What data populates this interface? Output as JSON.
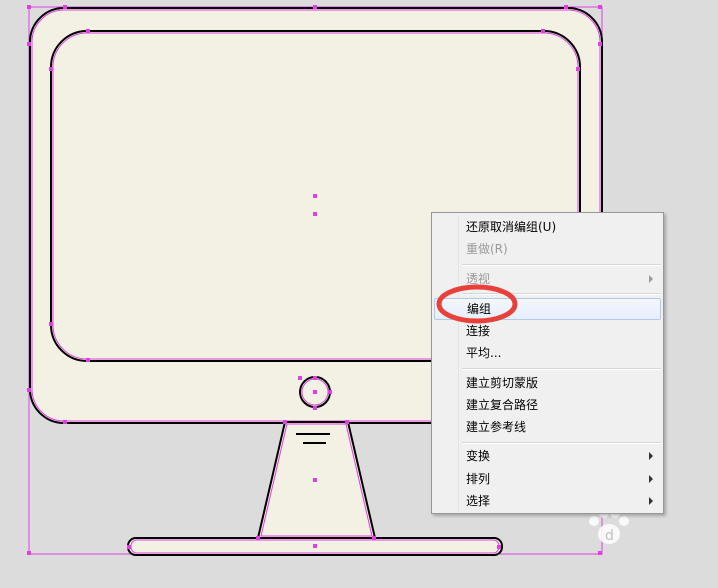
{
  "context_menu": {
    "items": [
      {
        "label": "还原取消编组(U)",
        "disabled": false,
        "submenu": false
      },
      {
        "label": "重做(R)",
        "disabled": true,
        "submenu": false
      },
      {
        "label": "透视",
        "disabled": true,
        "submenu": true
      },
      {
        "label": "编组",
        "disabled": false,
        "submenu": false,
        "highlighted": true,
        "circled": true
      },
      {
        "label": "连接",
        "disabled": false,
        "submenu": false
      },
      {
        "label": "平均...",
        "disabled": false,
        "submenu": false
      },
      {
        "label": "建立剪切蒙版",
        "disabled": false,
        "submenu": false
      },
      {
        "label": "建立复合路径",
        "disabled": false,
        "submenu": false
      },
      {
        "label": "建立参考线",
        "disabled": false,
        "submenu": false
      },
      {
        "label": "变换",
        "disabled": false,
        "submenu": true
      },
      {
        "label": "排列",
        "disabled": false,
        "submenu": true
      },
      {
        "label": "选择",
        "disabled": false,
        "submenu": true
      }
    ]
  },
  "watermark_text": "d",
  "colors": {
    "canvas_bg": "#dcdcdc",
    "monitor_fill": "#f3f0e4",
    "selection": "#e040e0",
    "annotation_circle": "#e8403a"
  },
  "icons": {
    "submenu_arrow": "triangle-right",
    "watermark": "paw-print-icon"
  }
}
